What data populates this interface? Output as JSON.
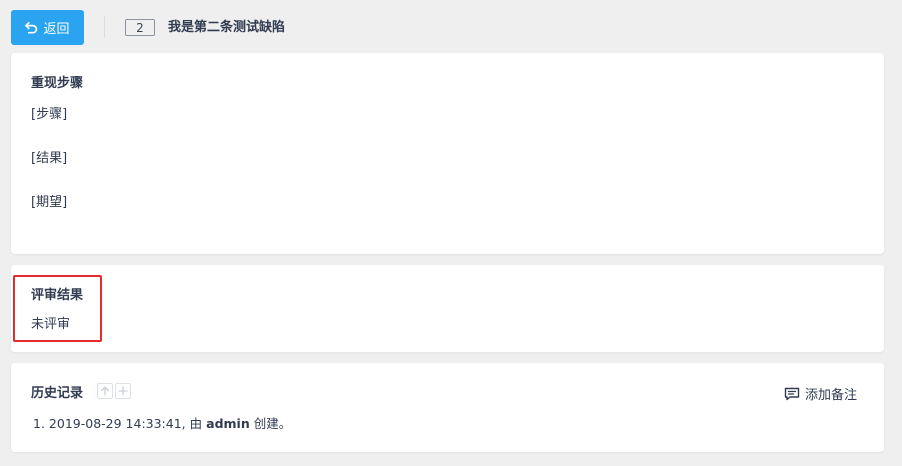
{
  "header": {
    "back_label": "返回",
    "bug_id": "2",
    "bug_title": "我是第二条测试缺陷"
  },
  "steps_panel": {
    "title": "重现步骤",
    "lines": [
      "[步骤]",
      "[结果]",
      "[期望]"
    ]
  },
  "review_panel": {
    "title": "评审结果",
    "value": "未评审"
  },
  "history_panel": {
    "title": "历史记录",
    "add_note_label": "添加备注",
    "entries": [
      {
        "index": "1.",
        "timestamp": "2019-08-29 14:33:41,",
        "by": "由",
        "user": "admin",
        "action": "创建。"
      }
    ]
  },
  "colors": {
    "accent": "#2aa3f1",
    "highlight": "#e52b2b",
    "background": "#efefef"
  },
  "icons": {
    "back": "undo-arrow-icon",
    "expand_up": "arrow-up-icon",
    "expand_add": "plus-icon",
    "note": "comment-icon"
  }
}
